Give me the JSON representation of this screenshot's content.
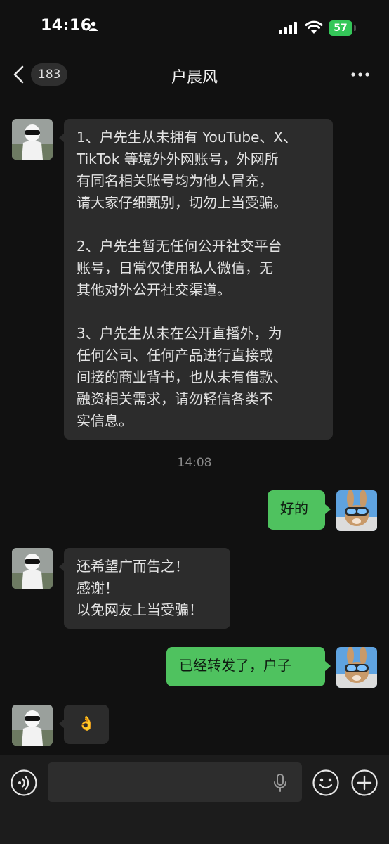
{
  "status_bar": {
    "time": "14:16",
    "battery": "57"
  },
  "nav": {
    "unread_count": "183",
    "title": "户晨风"
  },
  "messages": [
    {
      "sender": "contact",
      "text": "1、户先生从未拥有 YouTube、X、\nTikTok 等境外外网账号，外网所\n有同名相关账号均为他人冒充，\n请大家仔细甄别，切勿上当受骗。\n\n2、户先生暂无任何公开社交平台\n账号，日常仅使用私人微信，无\n其他对外公开社交渠道。\n\n3、户先生从未在公开直播外，为\n任何公司、任何产品进行直接或\n间接的商业背书，也从未有借款、\n融资相关需求，请勿轻信各类不\n实信息。"
    },
    {
      "sender": "me",
      "text": "好的"
    },
    {
      "sender": "contact",
      "text": "还希望广而告之！\n感谢！\n以免网友上当受骗！"
    },
    {
      "sender": "me",
      "text": "已经转发了，户子"
    },
    {
      "sender": "contact",
      "text": "👌"
    }
  ],
  "timestamp": "14:08",
  "colors": {
    "background": "#111111",
    "incoming_bubble": "#2c2c2c",
    "outgoing_bubble": "#4fc25f",
    "battery": "#34c759"
  }
}
